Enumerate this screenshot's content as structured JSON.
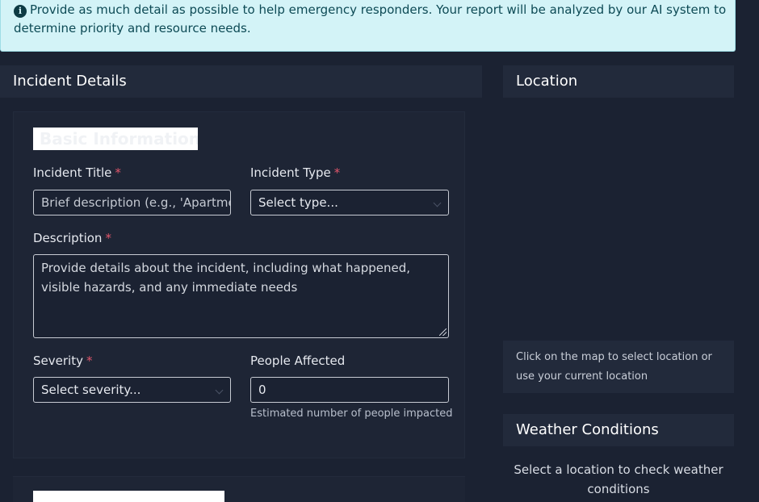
{
  "alert": {
    "line1": "Provide as much detail as possible to help emergency responders. Your report will be analyzed by our AI system to",
    "line2": "determine priority and resource needs."
  },
  "incident_details": {
    "header": "Incident Details",
    "basic_info_heading": "Basic Information",
    "title_field": {
      "label": "Incident Title",
      "required": "*",
      "placeholder": "Brief description (e.g., 'Apartme"
    },
    "type_field": {
      "label": "Incident Type",
      "required": "*",
      "value": "Select type..."
    },
    "description_field": {
      "label": "Description",
      "required": "*",
      "placeholder": "Provide details about the incident, including what happened, visible hazards, and any immediate needs"
    },
    "severity_field": {
      "label": "Severity",
      "required": "*",
      "value": "Select severity..."
    },
    "people_field": {
      "label": "People Affected",
      "value": "0",
      "help": "Estimated number of people impacted"
    }
  },
  "location": {
    "header": "Location",
    "hint": "Click on the map to select location or use your current location"
  },
  "weather": {
    "header": "Weather Conditions",
    "message": "Select a location to check weather conditions"
  }
}
